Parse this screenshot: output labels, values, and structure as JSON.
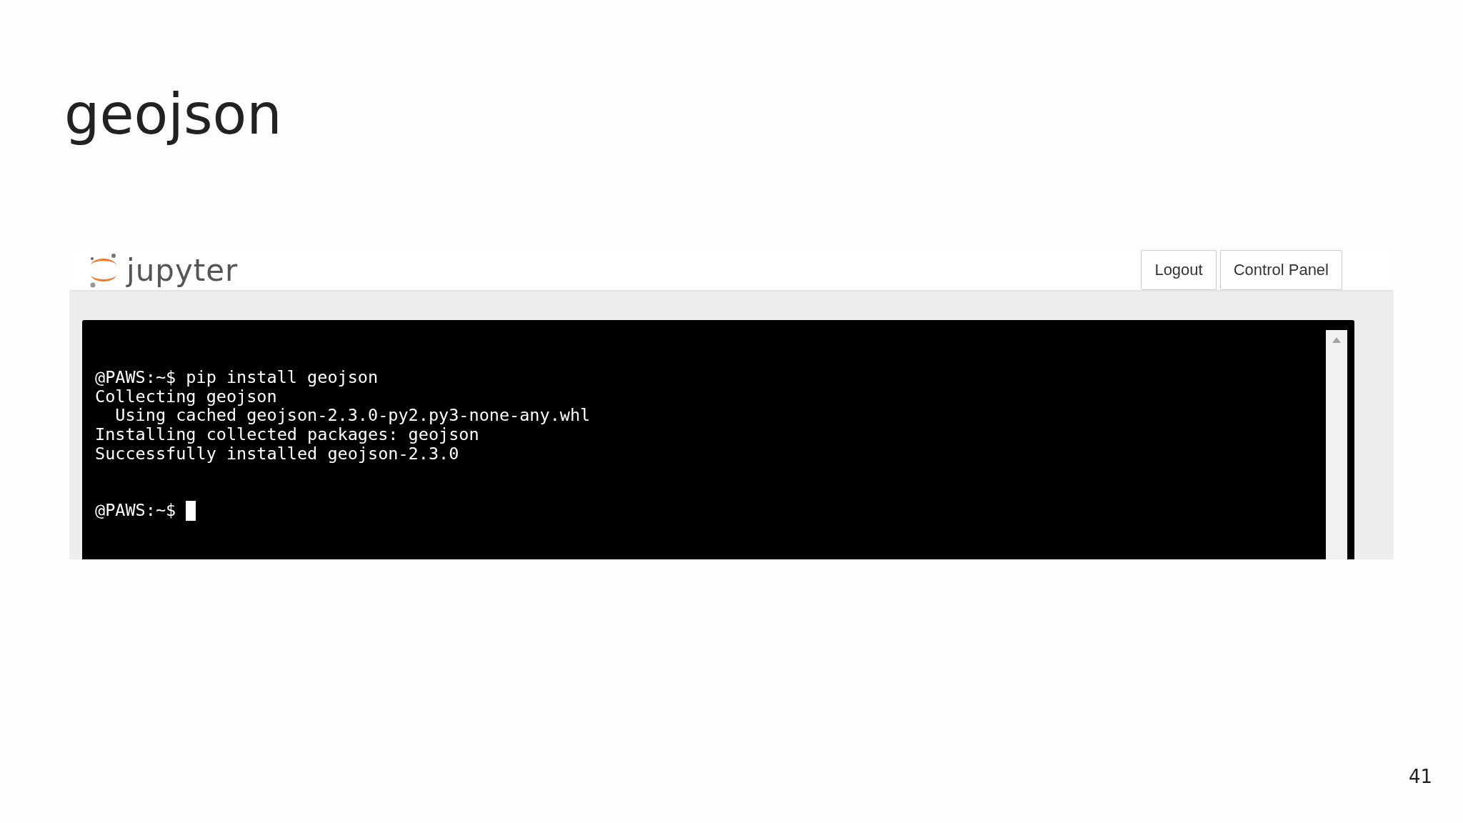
{
  "slide": {
    "title": "geojson",
    "page_number": "41"
  },
  "header": {
    "brand": "jupyter",
    "buttons": [
      "Logout",
      "Control Panel"
    ]
  },
  "terminal": {
    "lines": [
      "@PAWS:~$ pip install geojson",
      "Collecting geojson",
      "  Using cached geojson-2.3.0-py2.py3-none-any.whl",
      "Installing collected packages: geojson",
      "Successfully installed geojson-2.3.0"
    ],
    "prompt": "@PAWS:~$"
  }
}
